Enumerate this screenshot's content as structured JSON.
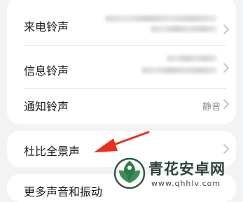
{
  "settings": {
    "rows": [
      {
        "label": "来电铃声",
        "value": ""
      },
      {
        "label": "信息铃声",
        "value": ""
      },
      {
        "label": "通知铃声",
        "value": "静音"
      },
      {
        "label": "杜比全景声",
        "value": ""
      },
      {
        "label": "更多声音和振动",
        "value": ""
      }
    ]
  },
  "annotation": {
    "arrow_color": "#e8321f"
  },
  "watermark": {
    "title": "青花安卓网",
    "url": "www.qhhlv.com"
  }
}
